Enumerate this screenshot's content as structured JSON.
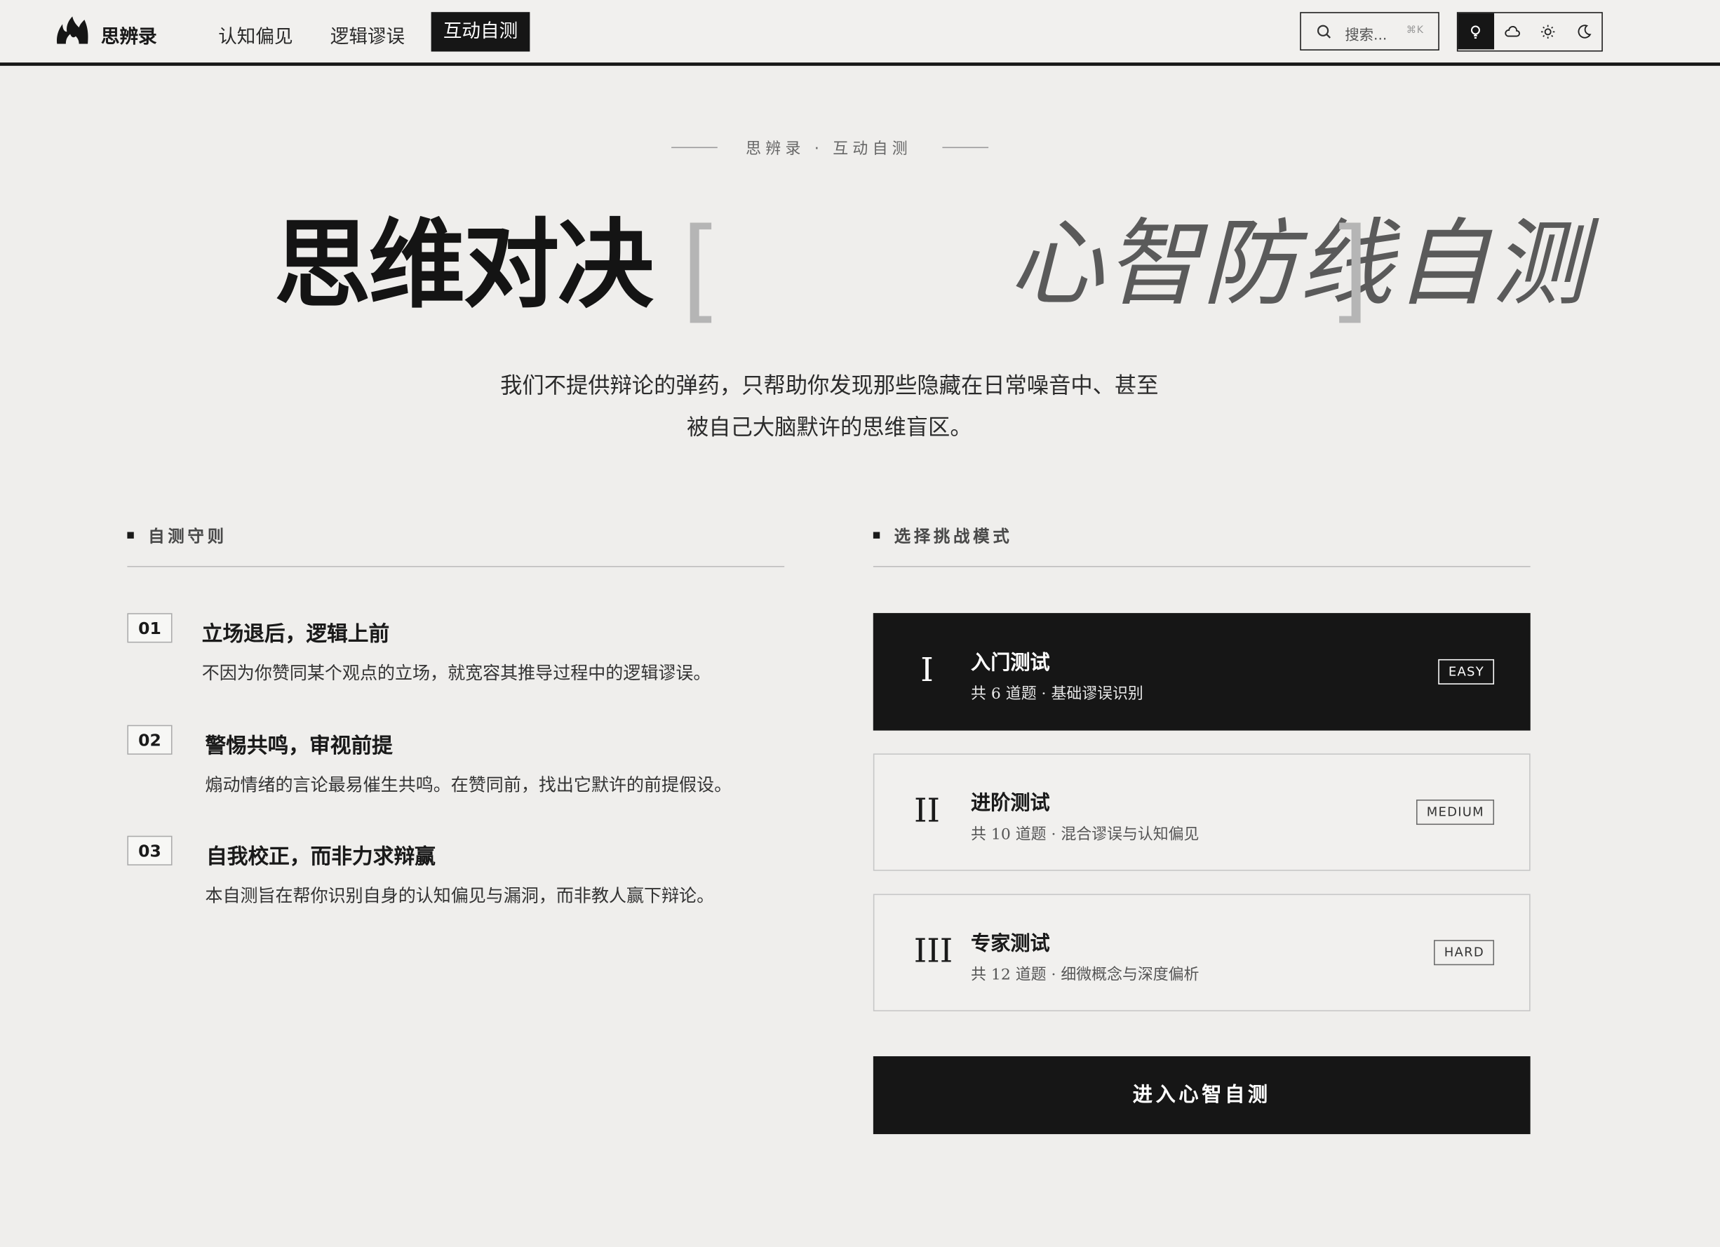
{
  "nav": {
    "brand": "思辨录",
    "links": [
      {
        "label": "认知偏见",
        "active": false
      },
      {
        "label": "逻辑谬误",
        "active": false
      },
      {
        "label": "互动自测",
        "active": true
      }
    ],
    "search": {
      "placeholder": "搜索...",
      "shortcut": "⌘K"
    },
    "themes": [
      "bulb-icon",
      "cloud-icon",
      "sun-icon",
      "moon-icon"
    ],
    "active_theme": "bulb-icon"
  },
  "hero": {
    "kicker_left": "思辨录",
    "kicker_sep": "·",
    "kicker_right": "互动自测",
    "title_main": "思维对决",
    "bracket_open": "[",
    "title_italic": "心智防线自测",
    "bracket_close": "]",
    "intro_line1": "我们不提供辩论的弹药，只帮助你发现那些隐藏在日常噪音中、甚至",
    "intro_line2": "被自己大脑默许的思维盲区。"
  },
  "rules_section": {
    "heading": "自测守则",
    "rules": [
      {
        "num": "01",
        "title": "立场退后，逻辑上前",
        "desc": "不因为你赞同某个观点的立场，就宽容其推导过程中的逻辑谬误。"
      },
      {
        "num": "02",
        "title": "警惕共鸣，审视前提",
        "desc": "煽动情绪的言论最易催生共鸣。在赞同前，找出它默许的前提假设。"
      },
      {
        "num": "03",
        "title": "自我校正，而非力求辩赢",
        "desc": "本自测旨在帮你识别自身的认知偏见与漏洞，而非教人赢下辩论。"
      }
    ]
  },
  "modes_section": {
    "heading": "选择挑战模式",
    "modes": [
      {
        "roman": "I",
        "title": "入门测试",
        "sub": "共 6 道题 · 基础谬误识别",
        "badge": "EASY",
        "selected": true
      },
      {
        "roman": "II",
        "title": "进阶测试",
        "sub": "共 10 道题 · 混合谬误与认知偏见",
        "badge": "MEDIUM",
        "selected": false
      },
      {
        "roman": "III",
        "title": "专家测试",
        "sub": "共 12 道题 · 细微概念与深度偏析",
        "badge": "HARD",
        "selected": false
      }
    ],
    "cta": "进入心智自测"
  },
  "colors": {
    "ink": "#161616",
    "paper": "#efeeec",
    "muted": "#5a5a5a"
  }
}
